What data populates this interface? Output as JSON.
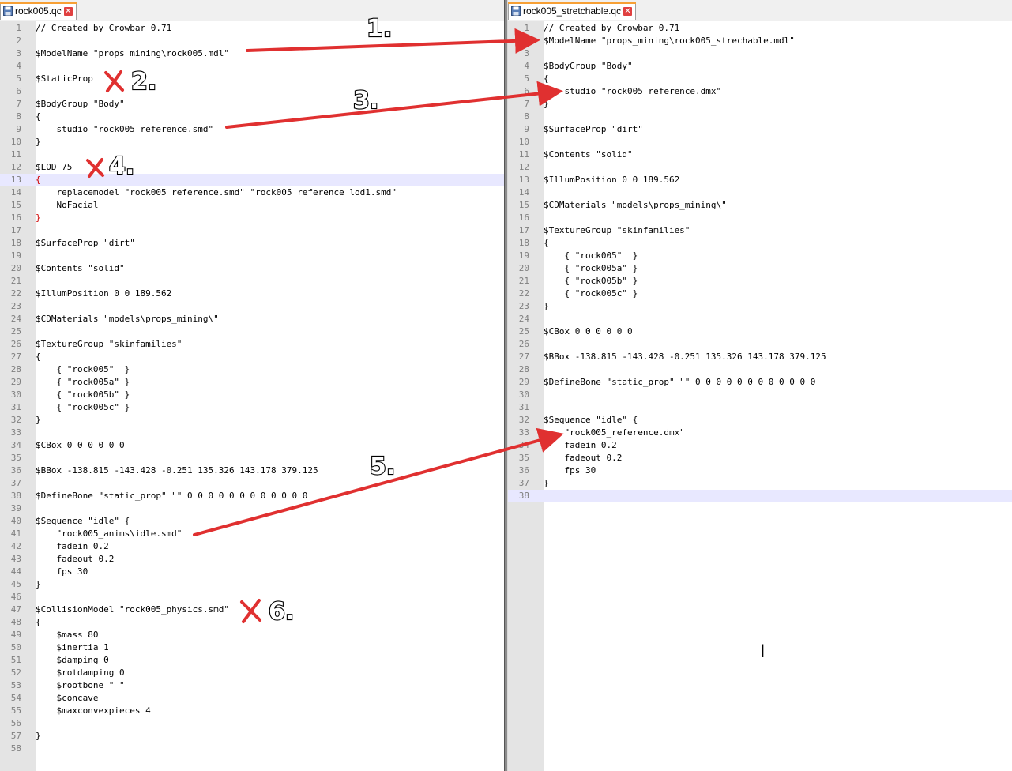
{
  "left": {
    "tab_title": "rock005.qc",
    "current_line": 13,
    "lines": [
      {
        "n": "1",
        "t": "// Created by Crowbar 0.71"
      },
      {
        "n": "2",
        "t": ""
      },
      {
        "n": "3",
        "t": "$ModelName \"props_mining\\rock005.mdl\""
      },
      {
        "n": "4",
        "t": ""
      },
      {
        "n": "5",
        "t": "$StaticProp"
      },
      {
        "n": "6",
        "t": ""
      },
      {
        "n": "7",
        "t": "$BodyGroup \"Body\""
      },
      {
        "n": "8",
        "t": "{"
      },
      {
        "n": "9",
        "t": "    studio \"rock005_reference.smd\""
      },
      {
        "n": "10",
        "t": "}"
      },
      {
        "n": "11",
        "t": ""
      },
      {
        "n": "12",
        "t": "$LOD 75"
      },
      {
        "n": "13",
        "t": "{",
        "red": true
      },
      {
        "n": "14",
        "t": "    replacemodel \"rock005_reference.smd\" \"rock005_reference_lod1.smd\""
      },
      {
        "n": "15",
        "t": "    NoFacial"
      },
      {
        "n": "16",
        "t": "}",
        "red": true
      },
      {
        "n": "17",
        "t": ""
      },
      {
        "n": "18",
        "t": "$SurfaceProp \"dirt\""
      },
      {
        "n": "19",
        "t": ""
      },
      {
        "n": "20",
        "t": "$Contents \"solid\""
      },
      {
        "n": "21",
        "t": ""
      },
      {
        "n": "22",
        "t": "$IllumPosition 0 0 189.562"
      },
      {
        "n": "23",
        "t": ""
      },
      {
        "n": "24",
        "t": "$CDMaterials \"models\\props_mining\\\""
      },
      {
        "n": "25",
        "t": ""
      },
      {
        "n": "26",
        "t": "$TextureGroup \"skinfamilies\""
      },
      {
        "n": "27",
        "t": "{"
      },
      {
        "n": "28",
        "t": "    { \"rock005\"  }"
      },
      {
        "n": "29",
        "t": "    { \"rock005a\" }"
      },
      {
        "n": "30",
        "t": "    { \"rock005b\" }"
      },
      {
        "n": "31",
        "t": "    { \"rock005c\" }"
      },
      {
        "n": "32",
        "t": "}"
      },
      {
        "n": "33",
        "t": ""
      },
      {
        "n": "34",
        "t": "$CBox 0 0 0 0 0 0"
      },
      {
        "n": "35",
        "t": ""
      },
      {
        "n": "36",
        "t": "$BBox -138.815 -143.428 -0.251 135.326 143.178 379.125"
      },
      {
        "n": "37",
        "t": ""
      },
      {
        "n": "38",
        "t": "$DefineBone \"static_prop\" \"\" 0 0 0 0 0 0 0 0 0 0 0 0"
      },
      {
        "n": "39",
        "t": ""
      },
      {
        "n": "40",
        "t": "$Sequence \"idle\" {"
      },
      {
        "n": "41",
        "t": "    \"rock005_anims\\idle.smd\""
      },
      {
        "n": "42",
        "t": "    fadein 0.2"
      },
      {
        "n": "43",
        "t": "    fadeout 0.2"
      },
      {
        "n": "44",
        "t": "    fps 30"
      },
      {
        "n": "45",
        "t": "}"
      },
      {
        "n": "46",
        "t": ""
      },
      {
        "n": "47",
        "t": "$CollisionModel \"rock005_physics.smd\""
      },
      {
        "n": "48",
        "t": "{"
      },
      {
        "n": "49",
        "t": "    $mass 80"
      },
      {
        "n": "50",
        "t": "    $inertia 1"
      },
      {
        "n": "51",
        "t": "    $damping 0"
      },
      {
        "n": "52",
        "t": "    $rotdamping 0"
      },
      {
        "n": "53",
        "t": "    $rootbone \" \""
      },
      {
        "n": "54",
        "t": "    $concave"
      },
      {
        "n": "55",
        "t": "    $maxconvexpieces 4"
      },
      {
        "n": "56",
        "t": ""
      },
      {
        "n": "57",
        "t": "}"
      },
      {
        "n": "58",
        "t": ""
      }
    ]
  },
  "right": {
    "tab_title": "rock005_stretchable.qc",
    "current_line": 38,
    "lines": [
      {
        "n": "1",
        "t": "// Created by Crowbar 0.71"
      },
      {
        "n": "2",
        "t": "$ModelName \"props_mining\\rock005_strechable.mdl\""
      },
      {
        "n": "3",
        "t": ""
      },
      {
        "n": "4",
        "t": "$BodyGroup \"Body\""
      },
      {
        "n": "5",
        "t": "{"
      },
      {
        "n": "6",
        "t": "    studio \"rock005_reference.dmx\""
      },
      {
        "n": "7",
        "t": "}"
      },
      {
        "n": "8",
        "t": ""
      },
      {
        "n": "9",
        "t": "$SurfaceProp \"dirt\""
      },
      {
        "n": "10",
        "t": ""
      },
      {
        "n": "11",
        "t": "$Contents \"solid\""
      },
      {
        "n": "12",
        "t": ""
      },
      {
        "n": "13",
        "t": "$IllumPosition 0 0 189.562"
      },
      {
        "n": "14",
        "t": ""
      },
      {
        "n": "15",
        "t": "$CDMaterials \"models\\props_mining\\\""
      },
      {
        "n": "16",
        "t": ""
      },
      {
        "n": "17",
        "t": "$TextureGroup \"skinfamilies\""
      },
      {
        "n": "18",
        "t": "{"
      },
      {
        "n": "19",
        "t": "    { \"rock005\"  }"
      },
      {
        "n": "20",
        "t": "    { \"rock005a\" }"
      },
      {
        "n": "21",
        "t": "    { \"rock005b\" }"
      },
      {
        "n": "22",
        "t": "    { \"rock005c\" }"
      },
      {
        "n": "23",
        "t": "}"
      },
      {
        "n": "24",
        "t": ""
      },
      {
        "n": "25",
        "t": "$CBox 0 0 0 0 0 0"
      },
      {
        "n": "26",
        "t": ""
      },
      {
        "n": "27",
        "t": "$BBox -138.815 -143.428 -0.251 135.326 143.178 379.125"
      },
      {
        "n": "28",
        "t": ""
      },
      {
        "n": "29",
        "t": "$DefineBone \"static_prop\" \"\" 0 0 0 0 0 0 0 0 0 0 0 0"
      },
      {
        "n": "30",
        "t": ""
      },
      {
        "n": "31",
        "t": ""
      },
      {
        "n": "32",
        "t": "$Sequence \"idle\" {"
      },
      {
        "n": "33",
        "t": "    \"rock005_reference.dmx\""
      },
      {
        "n": "34",
        "t": "    fadein 0.2"
      },
      {
        "n": "35",
        "t": "    fadeout 0.2"
      },
      {
        "n": "36",
        "t": "    fps 30"
      },
      {
        "n": "37",
        "t": "}"
      },
      {
        "n": "38",
        "t": ""
      }
    ]
  },
  "annotations": {
    "labels": [
      "1.",
      "2.",
      "3.",
      "4.",
      "5.",
      "6."
    ],
    "arrow_color": "#e03030",
    "cross_color": "#e03030"
  },
  "icons": {
    "tab_save": "save-icon",
    "tab_close": "close-icon",
    "cursor": "text-cursor-icon"
  }
}
